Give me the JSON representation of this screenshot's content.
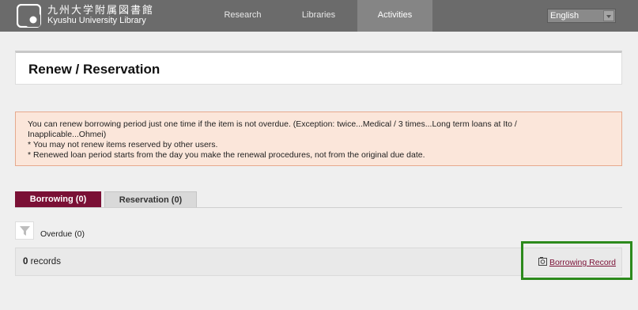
{
  "header": {
    "logo_jp": "九州大学附属図書館",
    "logo_en": "Kyushu University Library",
    "nav": [
      {
        "label": "Research"
      },
      {
        "label": "Libraries"
      },
      {
        "label": "Activities"
      }
    ],
    "language": "English"
  },
  "page": {
    "title": "Renew / Reservation"
  },
  "notice": {
    "lines": [
      "You can renew borrowing period just one time if the item is not overdue. (Exception: twice...Medical / 3 times...Long term loans at Ito /",
      "Inapplicable...Ohmei)",
      "* You may not renew items reserved by other users.",
      "* Renewed loan period starts from the day you make the renewal procedures, not from the original due date."
    ]
  },
  "tabs": [
    {
      "label": "Borrowing (0)"
    },
    {
      "label": "Reservation (0)"
    }
  ],
  "filter": {
    "icon": "filter-icon",
    "overdue_label": "Overdue (0)"
  },
  "records": {
    "count": "0",
    "suffix": " records",
    "link_label": "Borrowing Record",
    "link_icon": "history-icon"
  },
  "colors": {
    "header_bg": "#6b6b6b",
    "active_tab": "#7a1035",
    "highlight": "#2c8a1c",
    "notice_bg": "#fbe6da"
  }
}
